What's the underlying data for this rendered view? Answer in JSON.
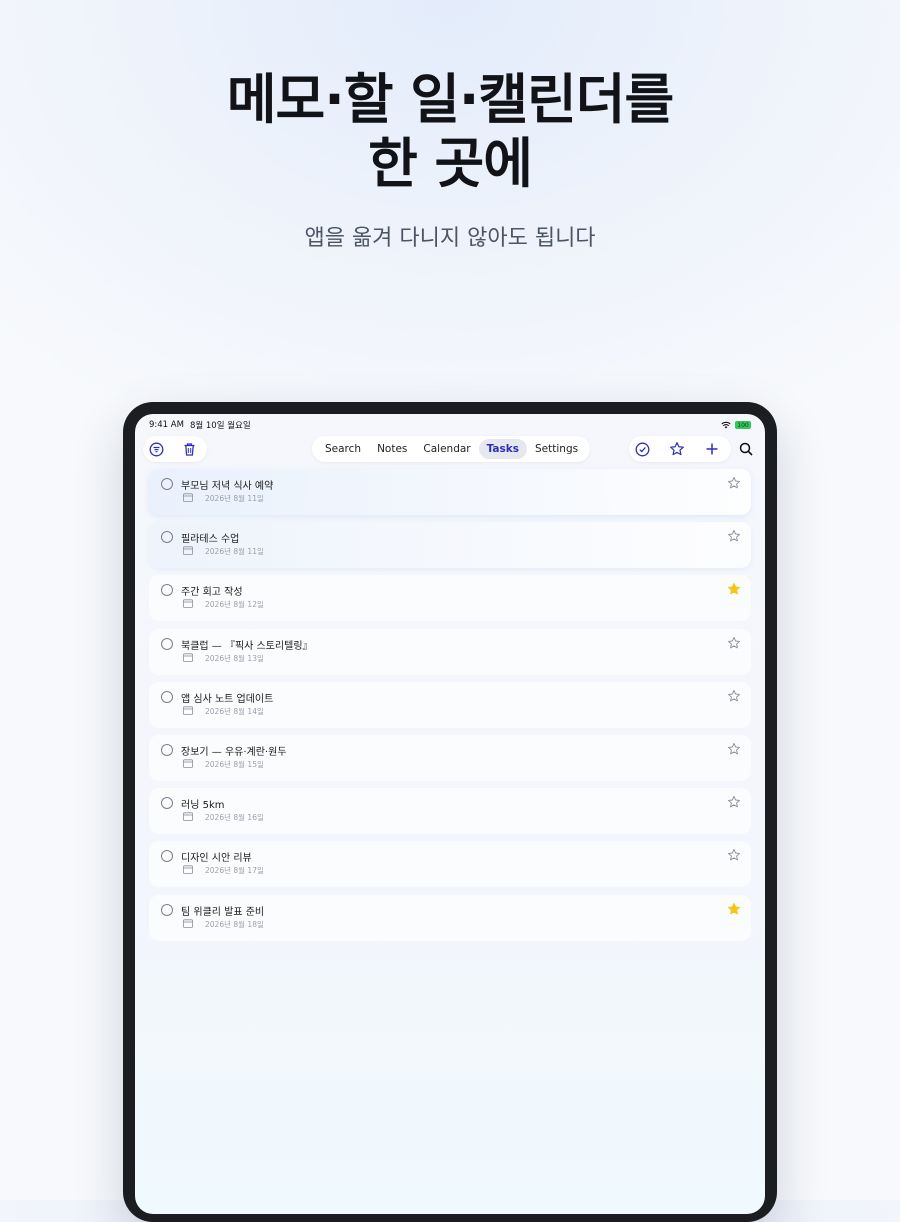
{
  "header": {
    "headline_line1": "메모·할 일·캘린더를",
    "headline_line2": "한 곳에",
    "subheadline": "앱을 옮겨 다니지 않아도 됩니다"
  },
  "status_bar": {
    "time": "9:41 AM",
    "date": "8월 10일 월요일",
    "battery": "100"
  },
  "tabs": [
    {
      "label": "Search",
      "active": false
    },
    {
      "label": "Notes",
      "active": false
    },
    {
      "label": "Calendar",
      "active": false
    },
    {
      "label": "Tasks",
      "active": true
    },
    {
      "label": "Settings",
      "active": false
    }
  ],
  "toolbar": {
    "left_icons": [
      "filter-icon",
      "trash-icon"
    ],
    "right_icons": [
      "checkmark-circle-icon",
      "star-icon",
      "plus-icon"
    ],
    "search_icon": "search-icon"
  },
  "colors": {
    "accent": "#2e2fb8",
    "star_filled": "#f5c518",
    "star_empty": "#8a8f98"
  },
  "tasks": [
    {
      "title": "부모님 저녁 식사 예약",
      "date": "2026년 8월 11일",
      "starred": false
    },
    {
      "title": "필라테스 수업",
      "date": "2026년 8월 11일",
      "starred": false
    },
    {
      "title": "주간 회고 작성",
      "date": "2026년 8월 12일",
      "starred": true
    },
    {
      "title": "북클럽 — 『픽사 스토리텔링』",
      "date": "2026년 8월 13일",
      "starred": false
    },
    {
      "title": "앱 심사 노트 업데이트",
      "date": "2026년 8월 14일",
      "starred": false
    },
    {
      "title": "장보기 — 우유·계란·원두",
      "date": "2026년 8월 15일",
      "starred": false
    },
    {
      "title": "러닝 5km",
      "date": "2026년 8월 16일",
      "starred": false
    },
    {
      "title": "디자인 시안 리뷰",
      "date": "2026년 8월 17일",
      "starred": false
    },
    {
      "title": "팀 위클리 발표 준비",
      "date": "2026년 8월 18일",
      "starred": true
    }
  ]
}
